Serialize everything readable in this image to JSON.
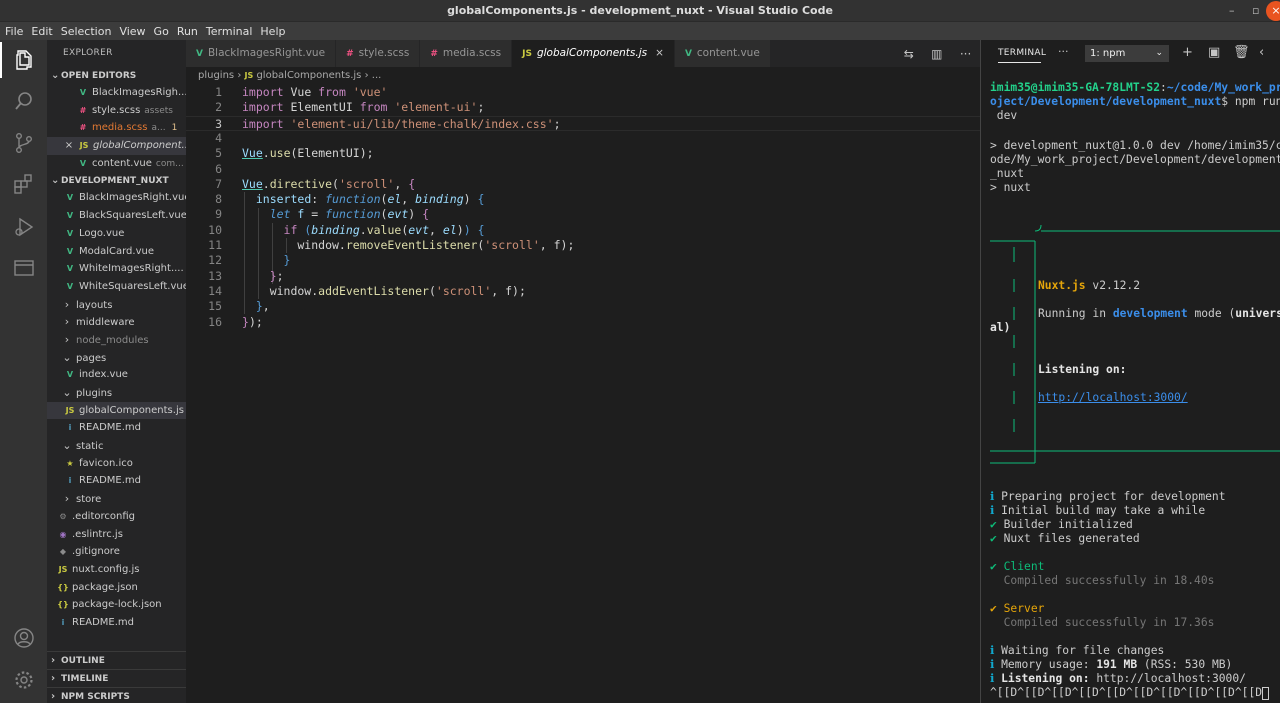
{
  "window": {
    "title": "globalComponents.js - development_nuxt - Visual Studio Code"
  },
  "menubar": [
    "File",
    "Edit",
    "Selection",
    "View",
    "Go",
    "Run",
    "Terminal",
    "Help"
  ],
  "activity_icons": [
    "files-icon",
    "search-icon",
    "source-control-icon",
    "extensions-icon",
    "run-debug-icon",
    "remote-explorer-icon",
    "account-icon",
    "settings-gear-icon"
  ],
  "sidebar": {
    "title": "EXPLORER",
    "open_editors_label": "OPEN EDITORS",
    "open_editors": [
      {
        "icon": "V",
        "name": "BlackImagesRigh...",
        "desc": "",
        "badge": "",
        "color": "vue"
      },
      {
        "icon": "#",
        "name": "style.scss",
        "desc": "assets",
        "badge": "",
        "color": "scss"
      },
      {
        "icon": "#",
        "name": "media.scss",
        "desc": "a...",
        "badge": "1",
        "color": "scss"
      },
      {
        "icon": "JS",
        "name": "globalComponent...",
        "desc": "",
        "badge": "",
        "color": "js"
      },
      {
        "icon": "V",
        "name": "content.vue",
        "desc": "com...",
        "badge": "",
        "color": "vue"
      }
    ],
    "project_label": "DEVELOPMENT_NUXT",
    "tree": [
      {
        "name": "BlackImagesRight.vue",
        "icon": "V",
        "kind": "vue",
        "indent": 1
      },
      {
        "name": "BlackSquaresLeft.vue",
        "icon": "V",
        "kind": "vue",
        "indent": 1
      },
      {
        "name": "Logo.vue",
        "icon": "V",
        "kind": "vue",
        "indent": 1
      },
      {
        "name": "ModalCard.vue",
        "icon": "V",
        "kind": "vue",
        "indent": 1
      },
      {
        "name": "WhiteImagesRight....",
        "icon": "V",
        "kind": "vue",
        "indent": 1
      },
      {
        "name": "WhiteSquaresLeft.vue",
        "icon": "V",
        "kind": "vue",
        "indent": 1
      },
      {
        "name": "layouts",
        "icon": ">",
        "kind": "folder",
        "indent": 0
      },
      {
        "name": "middleware",
        "icon": ">",
        "kind": "folder",
        "indent": 0
      },
      {
        "name": "node_modules",
        "icon": ">",
        "kind": "folder-dim",
        "indent": 0
      },
      {
        "name": "pages",
        "icon": "v",
        "kind": "folder",
        "indent": 0
      },
      {
        "name": "index.vue",
        "icon": "V",
        "kind": "vue",
        "indent": 1
      },
      {
        "name": "plugins",
        "icon": "v",
        "kind": "folder",
        "indent": 0
      },
      {
        "name": "globalComponents.js",
        "icon": "JS",
        "kind": "js",
        "indent": 1,
        "selected": true
      },
      {
        "name": "README.md",
        "icon": "i",
        "kind": "info",
        "indent": 1
      },
      {
        "name": "static",
        "icon": "v",
        "kind": "folder",
        "indent": 0
      },
      {
        "name": "favicon.ico",
        "icon": "★",
        "kind": "star",
        "indent": 1
      },
      {
        "name": "README.md",
        "icon": "i",
        "kind": "info",
        "indent": 1
      },
      {
        "name": "store",
        "icon": ">",
        "kind": "folder",
        "indent": 0
      },
      {
        "name": ".editorconfig",
        "icon": "⚙",
        "kind": "dim",
        "indent": 0
      },
      {
        "name": ".eslintrc.js",
        "icon": "◉",
        "kind": "cfg",
        "indent": 0
      },
      {
        "name": ".gitignore",
        "icon": "◆",
        "kind": "dim",
        "indent": 0
      },
      {
        "name": "nuxt.config.js",
        "icon": "JS",
        "kind": "js",
        "indent": 0
      },
      {
        "name": "package.json",
        "icon": "{}",
        "kind": "json",
        "indent": 0
      },
      {
        "name": "package-lock.json",
        "icon": "{}",
        "kind": "json",
        "indent": 0
      },
      {
        "name": "README.md",
        "icon": "i",
        "kind": "info",
        "indent": 0
      }
    ],
    "outline_label": "OUTLINE",
    "timeline_label": "TIMELINE",
    "npm_label": "NPM SCRIPTS"
  },
  "tabs": [
    {
      "icon": "V",
      "label": "BlackImagesRight.vue",
      "kind": "vue",
      "active": false
    },
    {
      "icon": "#",
      "label": "style.scss",
      "kind": "scss",
      "active": false
    },
    {
      "icon": "#",
      "label": "media.scss",
      "kind": "scss",
      "active": false
    },
    {
      "icon": "JS",
      "label": "globalComponents.js",
      "kind": "js",
      "active": true
    },
    {
      "icon": "V",
      "label": "content.vue",
      "kind": "vue",
      "active": false
    }
  ],
  "breadcrumb": {
    "folder": "plugins",
    "file": "globalComponents.js",
    "more": "..."
  },
  "editor": {
    "line_numbers": [
      "1",
      "2",
      "3",
      "4",
      "5",
      "6",
      "7",
      "8",
      "9",
      "10",
      "11",
      "12",
      "13",
      "14",
      "15",
      "16"
    ],
    "current_line": 3
  },
  "panel": {
    "title": "TERMINAL",
    "terminal_select": "1: npm"
  },
  "terminal": {
    "prompt_user": "imim35@imim35-GA-78LMT-S2",
    "prompt_path_1": "~/code/My_work_pr",
    "prompt_path_2": "oject/Development/development_nuxt",
    "command_1": "$ npm run",
    "command_2": " dev",
    "script_1": "> development_nuxt@1.0.0 dev /home/imim35/c",
    "script_2": "ode/My_work_project/Development/development",
    "script_3": "_nuxt",
    "script_4": "> nuxt",
    "nuxt_name": "Nuxt.js",
    "nuxt_version": " v2.12.2",
    "running_pre": "Running in ",
    "running_mode": "development",
    "running_post": " mode (",
    "running_univ": "univers",
    "running_end": "al)",
    "listening_label": "Listening on:",
    "listening_url": "http://localhost:3000/",
    "info_1": "Preparing project for development",
    "info_2": "Initial build may take a while",
    "ok_1": "Builder initialized",
    "ok_2": "Nuxt files generated",
    "client_label": "Client",
    "client_status": "Compiled successfully in 18.40s",
    "server_label": "Server",
    "server_status": "Compiled successfully in 17.36s",
    "waiting": "Waiting for file changes",
    "memory_pre": "Memory usage: ",
    "memory_value": "191 MB",
    "memory_post": " (RSS: 530 MB)",
    "listening_final_label": "Listening on:",
    "listening_final_url": " http://localhost:3000/",
    "escape_seq": "^[[D^[[D^[[D^[[D^[[D^[[D^[[D^[[D^[[D^[[D"
  }
}
